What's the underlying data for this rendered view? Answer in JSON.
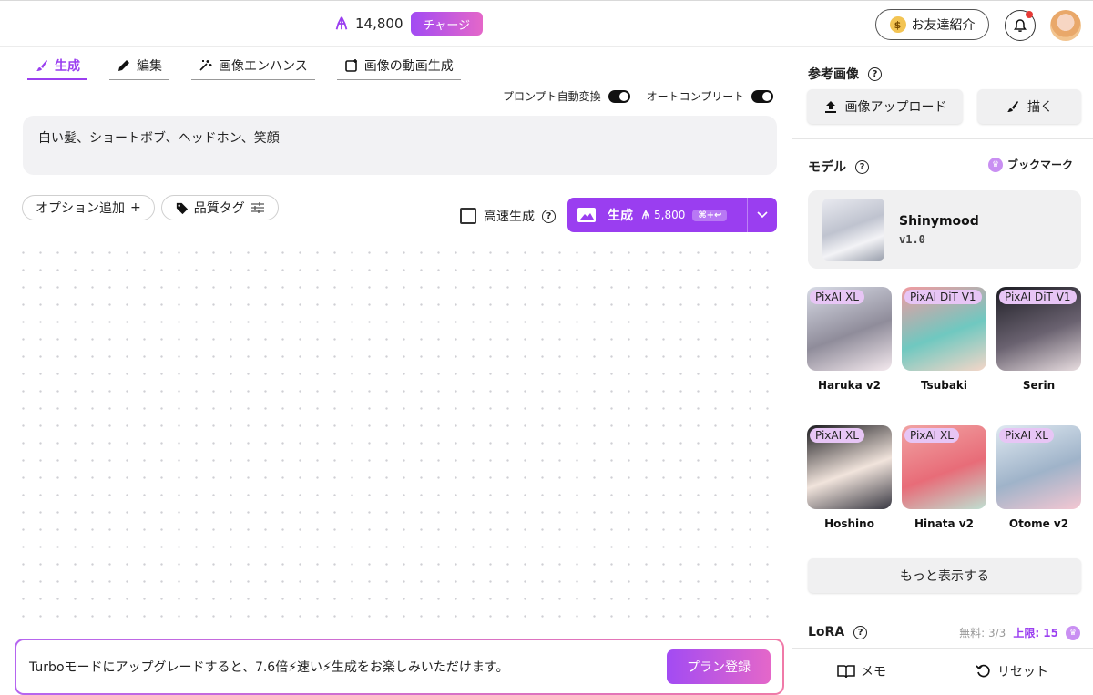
{
  "topbar": {
    "credits": "14,800",
    "charge_label": "チャージ",
    "invite_label": "お友達紹介",
    "invite_bag": "$"
  },
  "tabs": [
    {
      "label": "生成",
      "icon": "brush-icon",
      "active": true
    },
    {
      "label": "編集",
      "icon": "pencil-icon"
    },
    {
      "label": "画像エンハンス",
      "icon": "enhance-icon"
    },
    {
      "label": "画像の動画生成",
      "icon": "video-gen-icon"
    }
  ],
  "toggles": {
    "prompt_convert": "プロンプト自動変換",
    "autocomplete": "オートコンプリート"
  },
  "prompt": {
    "value": "白い髪、ショートボブ、ヘッドホン、笑顔"
  },
  "options": {
    "add_option": "オプション追加",
    "add_symbol": "+",
    "quality_tag": "品質タグ"
  },
  "fast_gen": {
    "label": "高速生成",
    "help": "?"
  },
  "generate": {
    "label": "生成",
    "cost": "5,800",
    "shortcut": "⌘+↩"
  },
  "banner": {
    "text": "Turboモードにアップグレードすると、7.6倍⚡速い⚡生成をお楽しみいただけます。",
    "plan_label": "プラン登録"
  },
  "right_panel": {
    "reference": {
      "title": "参考画像",
      "help": "?",
      "upload_label": "画像アップロード",
      "draw_label": "描く"
    },
    "model": {
      "title": "モデル",
      "help": "?",
      "bookmark_label": "ブックマーク",
      "crown": "♛",
      "selected_name": "Shinymood",
      "selected_version": "v1.0"
    },
    "models": [
      {
        "badge": "PixAI XL",
        "name": "Haruka v2",
        "colors": [
          "#d8dbe6",
          "#8f8c9a",
          "#f4e9ee"
        ]
      },
      {
        "badge": "PixAI DiT V1",
        "name": "Tsubaki",
        "colors": [
          "#f29aa0",
          "#6fc8c0",
          "#f5d6c8"
        ]
      },
      {
        "badge": "PixAI DiT V1",
        "name": "Serin",
        "colors": [
          "#1d1d24",
          "#6a6270",
          "#e8dde0"
        ]
      },
      {
        "badge": "PixAI XL",
        "name": "Hoshino",
        "colors": [
          "#1b1b20",
          "#f1e4dc",
          "#3a3a44"
        ]
      },
      {
        "badge": "PixAI XL",
        "name": "Hinata v2",
        "colors": [
          "#f1a3a3",
          "#e86c78",
          "#bfe0d2"
        ]
      },
      {
        "badge": "PixAI XL",
        "name": "Otome v2",
        "colors": [
          "#dfe9f1",
          "#9fb3c9",
          "#f4c7d2"
        ]
      }
    ],
    "more_label": "もっと表示する",
    "lora": {
      "title": "LoRA",
      "help": "?",
      "free": "無料: 3/3",
      "limit": "上限: 15",
      "crown": "♛"
    },
    "bottom": {
      "memo_label": "メモ",
      "reset_label": "リセット"
    }
  }
}
